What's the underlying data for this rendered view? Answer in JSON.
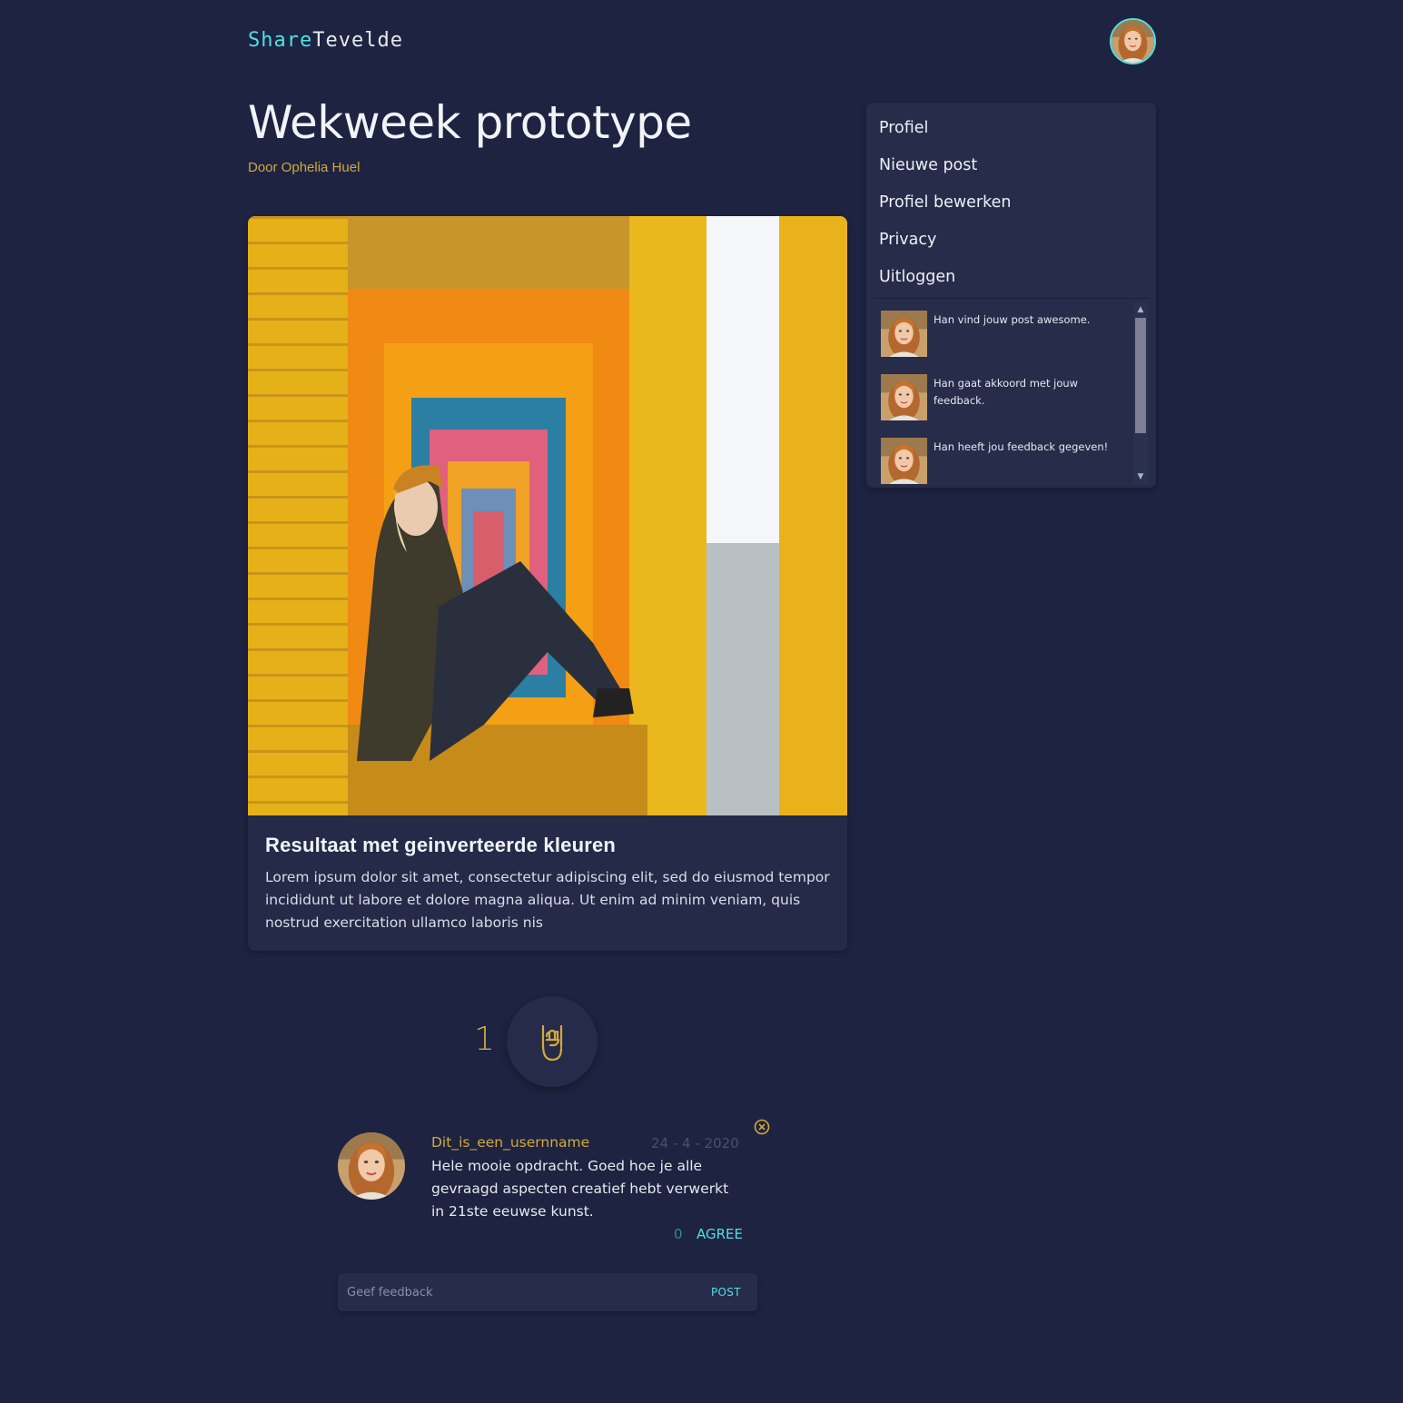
{
  "header": {
    "logo_part1": "Share",
    "logo_part2": "Tevelde"
  },
  "post": {
    "title": "Wekweek prototype",
    "author": "Door Ophelia Huel",
    "image_alt": "Woman with orange cap sitting in a corridor of colorful beach huts",
    "heading": "Resultaat met geinverteerde kleuren",
    "body": "Lorem ipsum dolor sit amet, consectetur adipiscing elit, sed do eiusmod tempor incididunt ut labore et dolore magna aliqua. Ut enim ad minim veniam, quis nostrud exercitation ullamco laboris nis"
  },
  "likes": {
    "count": "1",
    "icon": "rock-hand-icon"
  },
  "comment": {
    "username": "Dit_is_een_usernname",
    "date": "24 - 4 - 2020",
    "text": "Hele mooie opdracht. Goed hoe je alle gevraagd aspecten creatief hebt verwerkt in 21ste eeuwse kunst.",
    "agree_count": "0",
    "agree_label": "AGREE"
  },
  "feedback": {
    "placeholder": "Geef feedback",
    "post_label": "POST"
  },
  "menu": {
    "items": [
      {
        "label": "Profiel"
      },
      {
        "label": "Nieuwe post"
      },
      {
        "label": "Profiel bewerken"
      },
      {
        "label": "Privacy"
      },
      {
        "label": "Uitloggen"
      }
    ]
  },
  "notifications": [
    {
      "text": "Han vind jouw post awesome."
    },
    {
      "text": "Han gaat akkoord met jouw feedback."
    },
    {
      "text": "Han heeft jou feedback gegeven!"
    }
  ],
  "colors": {
    "background": "#1d2340",
    "card": "#242a48",
    "accent_cyan": "#4fe0e6",
    "accent_gold": "#d4a93c"
  }
}
